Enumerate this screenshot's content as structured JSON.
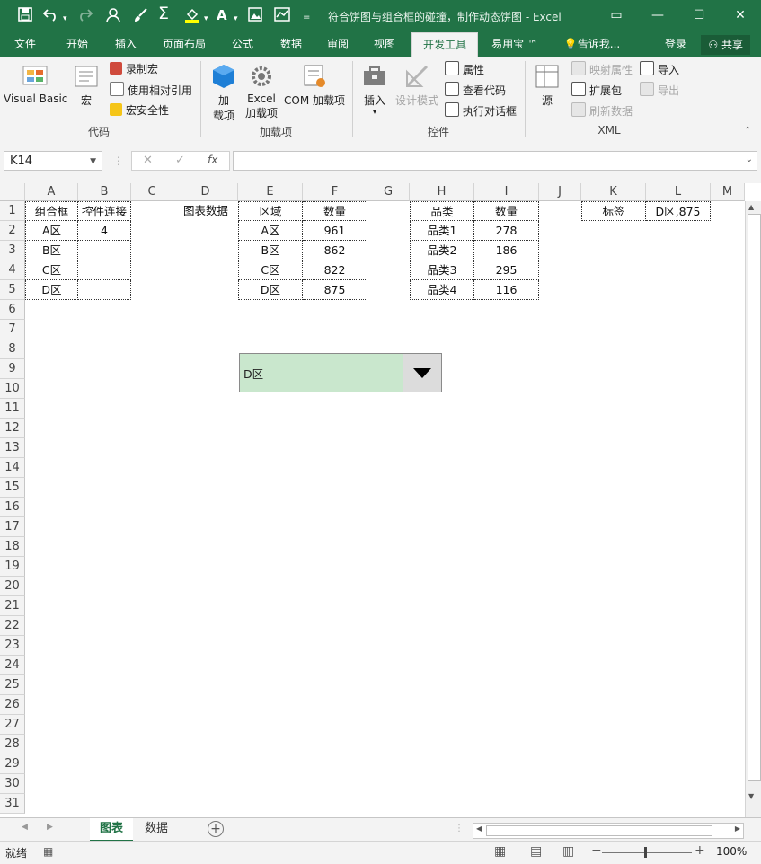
{
  "window": {
    "title": "符合饼图与组合框的碰撞，制作动态饼图 - Excel",
    "quick_access": [
      "save-icon",
      "undo-icon",
      "redo-icon",
      "user-icon",
      "brush-icon",
      "sum-icon",
      "fill-color-icon",
      "font-color-icon",
      "picture-icon",
      "chart-icon",
      "customize-icon"
    ]
  },
  "tabs": [
    {
      "label": "文件"
    },
    {
      "label": "开始"
    },
    {
      "label": "插入"
    },
    {
      "label": "页面布局"
    },
    {
      "label": "公式"
    },
    {
      "label": "数据"
    },
    {
      "label": "审阅"
    },
    {
      "label": "视图"
    },
    {
      "label": "开发工具"
    },
    {
      "label": "易用宝 ™"
    }
  ],
  "active_tab": "开发工具",
  "tell_me": "告诉我...",
  "login": "登录",
  "share": "共享",
  "ribbon": {
    "code": {
      "label": "代码",
      "visual_basic": "Visual Basic",
      "macros": "宏",
      "record_macro": "录制宏",
      "relative_ref": "使用相对引用",
      "macro_security": "宏安全性"
    },
    "addins": {
      "label": "加载项",
      "addins_1": "加",
      "addins_2": "载项",
      "excel_1": "Excel",
      "excel_2": "加载项",
      "com": "COM 加载项"
    },
    "controls": {
      "label": "控件",
      "insert": "插入",
      "design_mode": "设计模式",
      "properties": "属性",
      "view_code": "查看代码",
      "run_dialog": "执行对话框"
    },
    "xml": {
      "label": "XML",
      "source": "源",
      "map_props": "映射属性",
      "expansion": "扩展包",
      "refresh": "刷新数据",
      "import": "导入",
      "export": "导出"
    }
  },
  "formula_bar": {
    "name_box": "K14",
    "fx": "fx",
    "value": ""
  },
  "columns": [
    "A",
    "B",
    "C",
    "D",
    "E",
    "F",
    "G",
    "H",
    "I",
    "J",
    "K",
    "L",
    "M"
  ],
  "rows": [
    "1",
    "2",
    "3",
    "4",
    "5",
    "6",
    "7",
    "8",
    "9",
    "10",
    "11",
    "12",
    "13",
    "14",
    "15",
    "16",
    "17",
    "18",
    "19",
    "20",
    "21",
    "22",
    "23",
    "24",
    "25",
    "26",
    "27",
    "28",
    "29",
    "30",
    "31"
  ],
  "cells": {
    "A1": "组合框",
    "B1": "控件连接",
    "D1": "图表数据",
    "E1": "区域",
    "F1": "数量",
    "H1": "品类",
    "I1": "数量",
    "K1": "标签",
    "L1": "D区,875",
    "A2": "A区",
    "B2": "4",
    "E2": "A区",
    "F2": "961",
    "H2": "品类1",
    "I2": "278",
    "A3": "B区",
    "E3": "B区",
    "F3": "862",
    "H3": "品类2",
    "I3": "186",
    "A4": "C区",
    "E4": "C区",
    "F4": "822",
    "H4": "品类3",
    "I4": "295",
    "A5": "D区",
    "E5": "D区",
    "F5": "875",
    "H5": "品类4",
    "I5": "116"
  },
  "combo_box": {
    "value": "D区"
  },
  "sheets": [
    {
      "label": "图表"
    },
    {
      "label": "数据"
    }
  ],
  "active_sheet": "图表",
  "status": {
    "ready": "就绪",
    "zoom": "100%"
  },
  "colors": {
    "brand": "#217346",
    "combo_fill": "#c9e7cd"
  }
}
